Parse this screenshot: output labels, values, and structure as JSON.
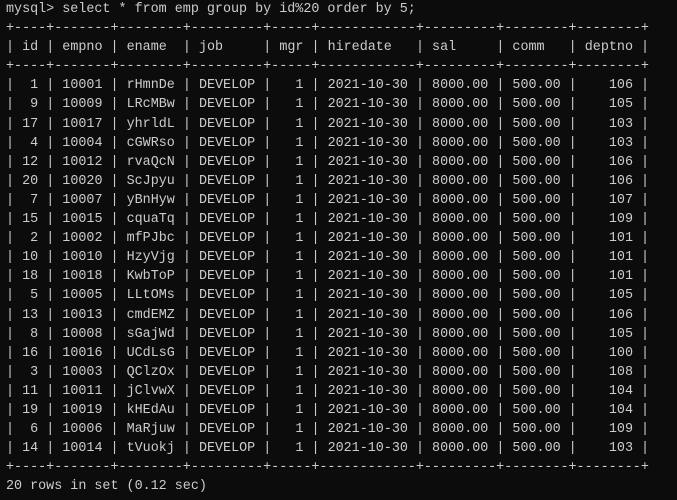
{
  "terminal": {
    "command_line": "mysql> select * from emp group by id%20 order by 5;",
    "border_line": "+----+-------+--------+---------+-----+------------+---------+--------+--------+",
    "columns": [
      "id",
      "empno",
      "ename",
      "job",
      "mgr",
      "hiredate",
      "sal",
      "comm",
      "deptno"
    ],
    "rows": [
      [
        "1",
        "10001",
        "rHmnDe",
        "DEVELOP",
        "1",
        "2021-10-30",
        "8000.00",
        "500.00",
        "106"
      ],
      [
        "9",
        "10009",
        "LRcMBw",
        "DEVELOP",
        "1",
        "2021-10-30",
        "8000.00",
        "500.00",
        "105"
      ],
      [
        "17",
        "10017",
        "yhrldL",
        "DEVELOP",
        "1",
        "2021-10-30",
        "8000.00",
        "500.00",
        "103"
      ],
      [
        "4",
        "10004",
        "cGWRso",
        "DEVELOP",
        "1",
        "2021-10-30",
        "8000.00",
        "500.00",
        "103"
      ],
      [
        "12",
        "10012",
        "rvaQcN",
        "DEVELOP",
        "1",
        "2021-10-30",
        "8000.00",
        "500.00",
        "106"
      ],
      [
        "20",
        "10020",
        "ScJpyu",
        "DEVELOP",
        "1",
        "2021-10-30",
        "8000.00",
        "500.00",
        "106"
      ],
      [
        "7",
        "10007",
        "yBnHyw",
        "DEVELOP",
        "1",
        "2021-10-30",
        "8000.00",
        "500.00",
        "107"
      ],
      [
        "15",
        "10015",
        "cquaTq",
        "DEVELOP",
        "1",
        "2021-10-30",
        "8000.00",
        "500.00",
        "109"
      ],
      [
        "2",
        "10002",
        "mfPJbc",
        "DEVELOP",
        "1",
        "2021-10-30",
        "8000.00",
        "500.00",
        "101"
      ],
      [
        "10",
        "10010",
        "HzyVjg",
        "DEVELOP",
        "1",
        "2021-10-30",
        "8000.00",
        "500.00",
        "101"
      ],
      [
        "18",
        "10018",
        "KwbToP",
        "DEVELOP",
        "1",
        "2021-10-30",
        "8000.00",
        "500.00",
        "101"
      ],
      [
        "5",
        "10005",
        "LLtOMs",
        "DEVELOP",
        "1",
        "2021-10-30",
        "8000.00",
        "500.00",
        "105"
      ],
      [
        "13",
        "10013",
        "cmdEMZ",
        "DEVELOP",
        "1",
        "2021-10-30",
        "8000.00",
        "500.00",
        "106"
      ],
      [
        "8",
        "10008",
        "sGajWd",
        "DEVELOP",
        "1",
        "2021-10-30",
        "8000.00",
        "500.00",
        "105"
      ],
      [
        "16",
        "10016",
        "UCdLsG",
        "DEVELOP",
        "1",
        "2021-10-30",
        "8000.00",
        "500.00",
        "100"
      ],
      [
        "3",
        "10003",
        "QClzOx",
        "DEVELOP",
        "1",
        "2021-10-30",
        "8000.00",
        "500.00",
        "108"
      ],
      [
        "11",
        "10011",
        "jClvwX",
        "DEVELOP",
        "1",
        "2021-10-30",
        "8000.00",
        "500.00",
        "104"
      ],
      [
        "19",
        "10019",
        "kHEdAu",
        "DEVELOP",
        "1",
        "2021-10-30",
        "8000.00",
        "500.00",
        "104"
      ],
      [
        "6",
        "10006",
        "MaRjuw",
        "DEVELOP",
        "1",
        "2021-10-30",
        "8000.00",
        "500.00",
        "109"
      ],
      [
        "14",
        "10014",
        "tVuokj",
        "DEVELOP",
        "1",
        "2021-10-30",
        "8000.00",
        "500.00",
        "103"
      ]
    ],
    "result_summary": "20 rows in set (0.12 sec)"
  }
}
